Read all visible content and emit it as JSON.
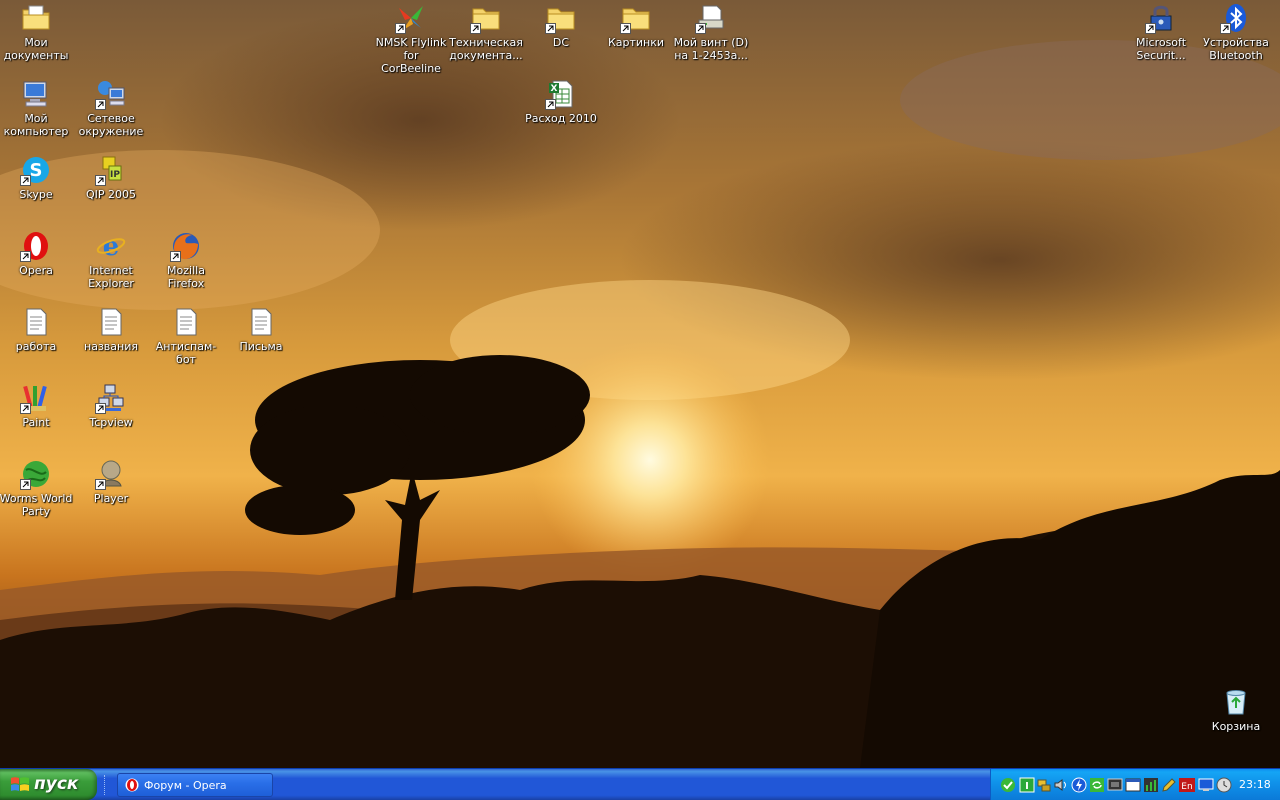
{
  "desktop": {
    "icons": {
      "my_documents": "Мои документы",
      "my_computer": "Мой компьютер",
      "network": "Сетевое окружение",
      "skype": "Skype",
      "qip": "QIP 2005",
      "opera": "Opera",
      "ie": "Internet Explorer",
      "firefox": "Mozilla Firefox",
      "rabota": "работа",
      "nazvaniya": "названия",
      "antispam": "Антиспам-бот",
      "pisma": "Письма",
      "paint": "Paint",
      "tcpview": "Tcpview",
      "worms": "Worms World Party",
      "player": "Player",
      "flylink": "NMSK Flylink for CorBeeline",
      "tech_docs": "Техническая документа...",
      "dc": "DC",
      "pictures": "Картинки",
      "my_drive": "Мой винт (D) на 1-2453а...",
      "expenses": "Расход 2010",
      "ms_security": "Microsoft Securit...",
      "bluetooth": "Устройства Bluetooth",
      "recycle": "Корзина"
    }
  },
  "taskbar": {
    "start_label": "пуск",
    "task_opera": "Форум - Opera",
    "clock": "23:18",
    "tray_lang": "En"
  },
  "colors": {
    "taskbar_blue": "#2157d7",
    "start_green": "#3a9d3a",
    "tray_blue": "#0f8fe8"
  }
}
